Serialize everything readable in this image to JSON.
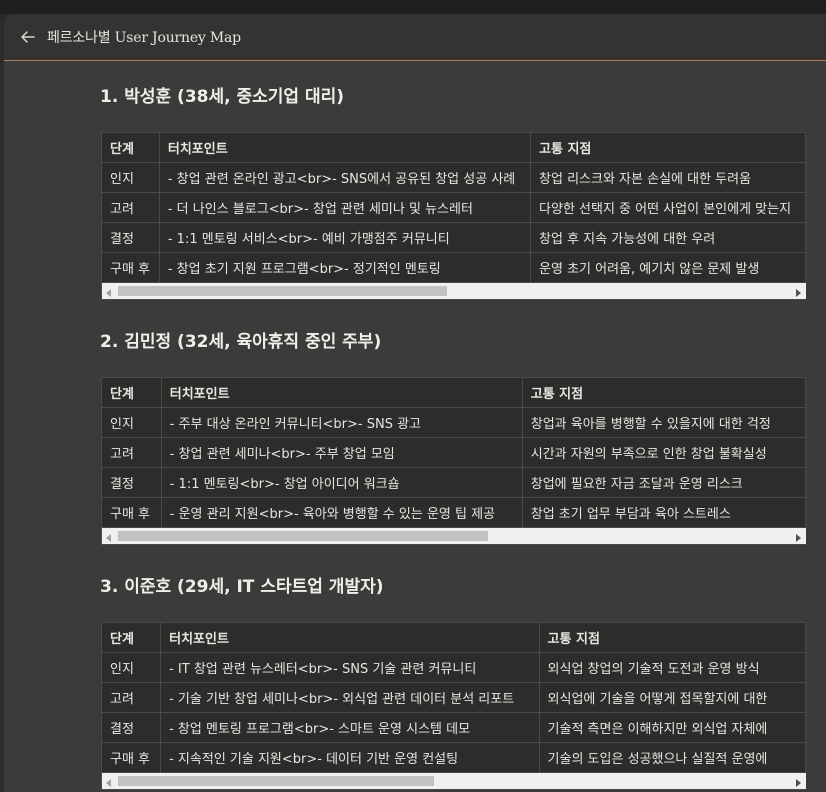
{
  "window": {
    "title": "페르소나별 User Journey Map"
  },
  "icons": {
    "back": "back-arrow-icon",
    "scroll_left": "triangle-left-icon",
    "scroll_right": "triangle-right-icon"
  },
  "colors": {
    "accent_line": "#b07a5a",
    "background": "#3b3b39",
    "table_bg": "#2c2c2a"
  },
  "sections": [
    {
      "heading": "1. 박성훈 (38세, 중소기업 대리)",
      "columns": [
        "단계",
        "터치포인트",
        "고통 지점"
      ],
      "rows": [
        [
          "인지",
          "- 창업 관련 온라인 광고<br>- SNS에서 공유된 창업 성공 사례",
          "창업 리스크와 자본 손실에 대한 두려움"
        ],
        [
          "고려",
          "- 더 나인스 블로그<br>- 창업 관련 세미나 및 뉴스레터",
          "다양한 선택지 중 어떤 사업이 본인에게 맞는지"
        ],
        [
          "결정",
          "- 1:1 멘토링 서비스<br>- 예비 가맹점주 커뮤니티",
          "창업 후 지속 가능성에 대한 우려"
        ],
        [
          "구매 후",
          "- 창업 초기 지원 프로그램<br>- 정기적인 멘토링",
          "운영 초기 어려움, 예기치 않은 문제 발생"
        ]
      ],
      "scroll_fraction": 0.49
    },
    {
      "heading": "2. 김민정 (32세, 육아휴직 중인 주부)",
      "columns": [
        "단계",
        "터치포인트",
        "고통 지점"
      ],
      "rows": [
        [
          "인지",
          "- 주부 대상 온라인 커뮤니티<br>- SNS 광고",
          "창업과 육아를 병행할 수 있을지에 대한 걱정"
        ],
        [
          "고려",
          "- 창업 관련 세미나<br>- 주부 창업 모임",
          "시간과 자원의 부족으로 인한 창업 불확실성"
        ],
        [
          "결정",
          "- 1:1 멘토링<br>- 창업 아이디어 워크숍",
          "창업에 필요한 자금 조달과 운영 리스크"
        ],
        [
          "구매 후",
          "- 운영 관리 지원<br>- 육아와 병행할 수 있는 운영 팁 제공",
          "창업 초기 업무 부담과 육아 스트레스"
        ]
      ],
      "scroll_fraction": 0.55
    },
    {
      "heading": "3. 이준호 (29세, IT 스타트업 개발자)",
      "columns": [
        "단계",
        "터치포인트",
        "고통 지점"
      ],
      "rows": [
        [
          "인지",
          "- IT 창업 관련 뉴스레터<br>- SNS 기술 관련 커뮤니티",
          "외식업 창업의 기술적 도전과 운영 방식"
        ],
        [
          "고려",
          "- 기술 기반 창업 세미나<br>- 외식업 관련 데이터 분석 리포트",
          "외식업에 기술을 어떻게 접목할지에 대한"
        ],
        [
          "결정",
          "- 창업 멘토링 프로그램<br>- 스마트 운영 시스템 데모",
          "기술적 측면은 이해하지만 외식업 자체에"
        ],
        [
          "구매 후",
          "- 지속적인 기술 지원<br>- 데이터 기반 운영 컨설팅",
          "기술의 도입은 성공했으나 실질적 운영에"
        ]
      ],
      "scroll_fraction": 0.47
    }
  ]
}
